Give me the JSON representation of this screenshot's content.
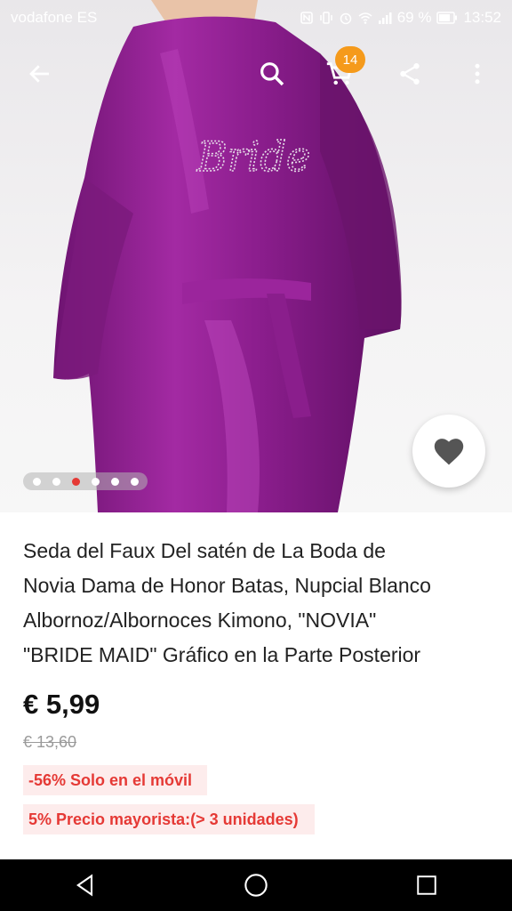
{
  "status_bar": {
    "carrier": "vodafone ES",
    "battery": "69 %",
    "time": "13:52",
    "icons": [
      "nfc-icon",
      "vibrate-icon",
      "alarm-icon",
      "wifi-icon",
      "signal-icon",
      "battery-icon"
    ]
  },
  "topbar": {
    "back_icon": "back-arrow-icon",
    "search_icon": "search-icon",
    "cart_icon": "cart-icon",
    "cart_count": "14",
    "share_icon": "share-icon",
    "menu_icon": "more-vert-icon"
  },
  "image": {
    "embroidery_text": "Bride",
    "dots_total": 6,
    "dots_active_index": 2,
    "wishlist_icon": "heart-icon"
  },
  "product": {
    "title_lines": [
      "Seda del Faux Del satén de La Boda de",
      "Novia Dama de Honor Batas, Nupcial Blanco",
      "Albornoz/Albornoces Kimono, \"NOVIA\"",
      "\"BRIDE MAID\" Gráfico en la Parte Posterior"
    ],
    "price": "€ 5,99",
    "old_price": "€ 13,60",
    "discount_tag": "-56%  Solo en el móvil",
    "wholesale_tag": "5%  Precio mayorista:(> 3 unidades)"
  },
  "colors": {
    "accent": "#e53935",
    "badge": "#f59a1b",
    "robe": "#8e1f8e"
  },
  "navbar": {
    "back_icon": "nav-back-icon",
    "home_icon": "nav-home-icon",
    "recents_icon": "nav-recents-icon"
  }
}
